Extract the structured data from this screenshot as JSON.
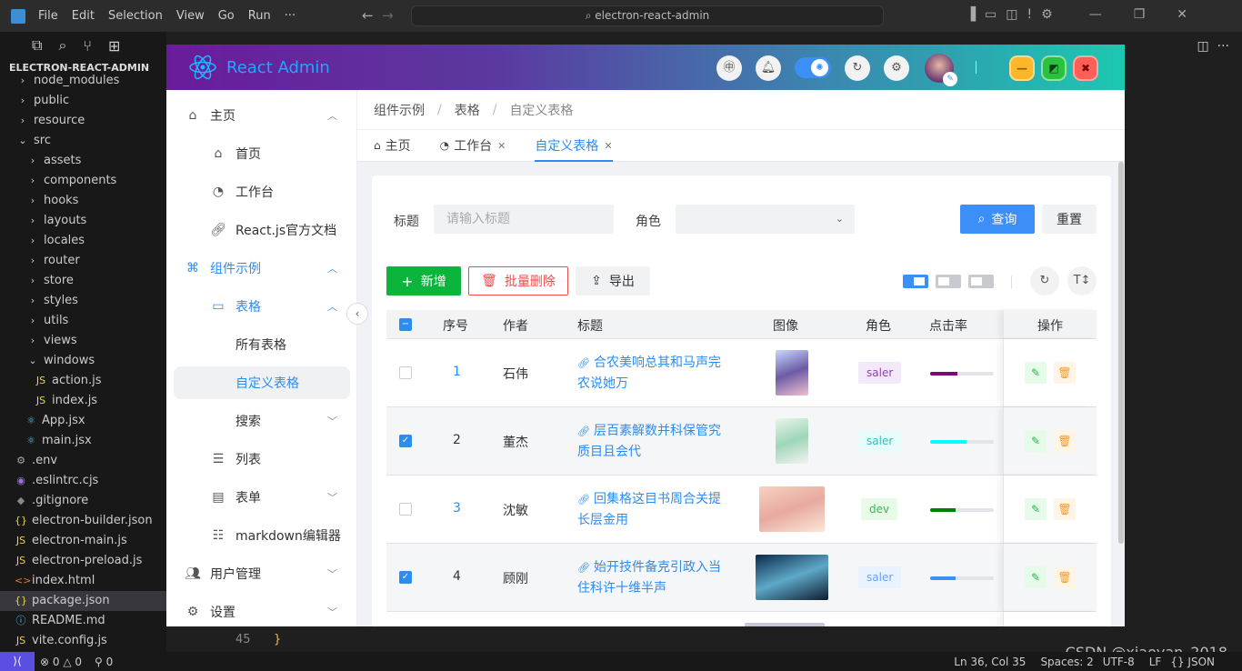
{
  "vscode": {
    "menu": [
      "File",
      "Edit",
      "Selection",
      "View",
      "Go",
      "Run",
      "···"
    ],
    "command_center": "electron-react-admin",
    "explorer_title": "ELECTRON-REACT-ADMIN",
    "files": [
      {
        "name": "node_modules",
        "kind": "folder",
        "depth": 0
      },
      {
        "name": "public",
        "kind": "folder",
        "depth": 0
      },
      {
        "name": "resource",
        "kind": "folder",
        "depth": 0
      },
      {
        "name": "src",
        "kind": "folder-open",
        "depth": 0
      },
      {
        "name": "assets",
        "kind": "folder",
        "depth": 1
      },
      {
        "name": "components",
        "kind": "folder",
        "depth": 1
      },
      {
        "name": "hooks",
        "kind": "folder",
        "depth": 1
      },
      {
        "name": "layouts",
        "kind": "folder",
        "depth": 1
      },
      {
        "name": "locales",
        "kind": "folder",
        "depth": 1
      },
      {
        "name": "router",
        "kind": "folder",
        "depth": 1
      },
      {
        "name": "store",
        "kind": "folder",
        "depth": 1
      },
      {
        "name": "styles",
        "kind": "folder",
        "depth": 1
      },
      {
        "name": "utils",
        "kind": "folder",
        "depth": 1
      },
      {
        "name": "views",
        "kind": "folder",
        "depth": 1
      },
      {
        "name": "windows",
        "kind": "folder-open",
        "depth": 1
      },
      {
        "name": "action.js",
        "kind": "js",
        "depth": 2
      },
      {
        "name": "index.js",
        "kind": "js",
        "depth": 2
      },
      {
        "name": "App.jsx",
        "kind": "react",
        "depth": 1
      },
      {
        "name": "main.jsx",
        "kind": "react",
        "depth": 1
      },
      {
        "name": ".env",
        "kind": "gear",
        "depth": 0
      },
      {
        "name": ".eslintrc.cjs",
        "kind": "eslint",
        "depth": 0
      },
      {
        "name": ".gitignore",
        "kind": "git",
        "depth": 0
      },
      {
        "name": "electron-builder.json",
        "kind": "json",
        "depth": 0
      },
      {
        "name": "electron-main.js",
        "kind": "js",
        "depth": 0
      },
      {
        "name": "electron-preload.js",
        "kind": "js",
        "depth": 0
      },
      {
        "name": "index.html",
        "kind": "html",
        "depth": 0
      },
      {
        "name": "package.json",
        "kind": "json",
        "depth": 0,
        "selected": true
      },
      {
        "name": "README.md",
        "kind": "info",
        "depth": 0
      },
      {
        "name": "vite.config.js",
        "kind": "js",
        "depth": 0
      }
    ],
    "line_number": "45",
    "code_line": "}",
    "status": {
      "errors": "0",
      "warnings": "0",
      "ports": "0",
      "position": "Ln 36, Col 35",
      "spaces": "Spaces: 2",
      "encoding": "UTF-8",
      "eol": "LF",
      "language": "{} JSON"
    },
    "watermark": "CSDN @xiaoyan_2018"
  },
  "app": {
    "brand": "React Admin",
    "accent": "#2d8cf0",
    "header_icons": [
      "language-icon",
      "bell-icon",
      "theme-toggle",
      "refresh-icon",
      "settings-icon"
    ],
    "window_buttons": {
      "minimize": "—",
      "maximize": "◩",
      "close": "✖"
    },
    "sidebar": [
      {
        "label": "主页",
        "icon": "home-icon",
        "chev": "up"
      },
      {
        "label": "首页",
        "icon": "home-icon",
        "sub": true
      },
      {
        "label": "工作台",
        "icon": "dashboard-icon",
        "sub": true
      },
      {
        "label": "React.js官方文档",
        "icon": "link-icon",
        "sub": true
      },
      {
        "label": "组件示例",
        "icon": "command-icon",
        "chev": "up",
        "active": true
      },
      {
        "label": "表格",
        "icon": "table-icon",
        "chev": "up",
        "sub": true,
        "active": true
      },
      {
        "label": "所有表格",
        "sub2": true
      },
      {
        "label": "自定义表格",
        "sub2": true,
        "selected": true
      },
      {
        "label": "搜索",
        "sub2": true,
        "chev": "down"
      },
      {
        "label": "列表",
        "icon": "list-icon",
        "sub": true
      },
      {
        "label": "表单",
        "icon": "form-icon",
        "sub": true,
        "chev": "down"
      },
      {
        "label": "markdown编辑器",
        "icon": "markdown-icon",
        "sub": true
      },
      {
        "label": "用户管理",
        "icon": "users-icon",
        "chev": "down"
      },
      {
        "label": "设置",
        "icon": "settings-icon",
        "chev": "down"
      }
    ],
    "breadcrumb": [
      "组件示例",
      "表格",
      "自定义表格"
    ],
    "tabs": [
      {
        "label": "主页",
        "icon": "home-icon"
      },
      {
        "label": "工作台",
        "icon": "dashboard-icon",
        "closable": true
      },
      {
        "label": "自定义表格",
        "closable": true,
        "active": true
      }
    ],
    "search": {
      "title_label": "标题",
      "title_placeholder": "请输入标题",
      "role_label": "角色",
      "role_value": "",
      "query": "查询",
      "reset": "重置"
    },
    "toolbar": {
      "add": "新增",
      "batch_delete": "批量删除",
      "export": "导出"
    },
    "table": {
      "columns": [
        "序号",
        "作者",
        "标题",
        "图像",
        "角色",
        "点击率",
        "操作"
      ],
      "rows": [
        {
          "no": "1",
          "author": "石伟",
          "title": "合农美响总其和马声完农说她万",
          "role": "saler",
          "role_color": "#8e44ad",
          "role_bg": "#f4e9fb",
          "click_rate": 43,
          "bar_color": "#800080",
          "checked": false
        },
        {
          "no": "2",
          "author": "董杰",
          "title": "层百素解数并科保管究质目且会代",
          "role": "saler",
          "role_color": "#30c0c0",
          "role_bg": "#e8fbfb",
          "click_rate": 57,
          "bar_color": "#00ffff",
          "checked": true
        },
        {
          "no": "3",
          "author": "沈敏",
          "title": "回集格这目书周合关提长层金用",
          "role": "dev",
          "role_color": "#2ebd59",
          "role_bg": "#e8fbe8",
          "click_rate": 40,
          "bar_color": "#008000",
          "checked": false
        },
        {
          "no": "4",
          "author": "顾刚",
          "title": "始开技件备克引政入当住科许十维半声",
          "role": "saler",
          "role_color": "#6a9ef5",
          "role_bg": "#e8f3ff",
          "click_rate": 40,
          "bar_color": "#3b8ff7",
          "checked": true
        }
      ]
    }
  }
}
